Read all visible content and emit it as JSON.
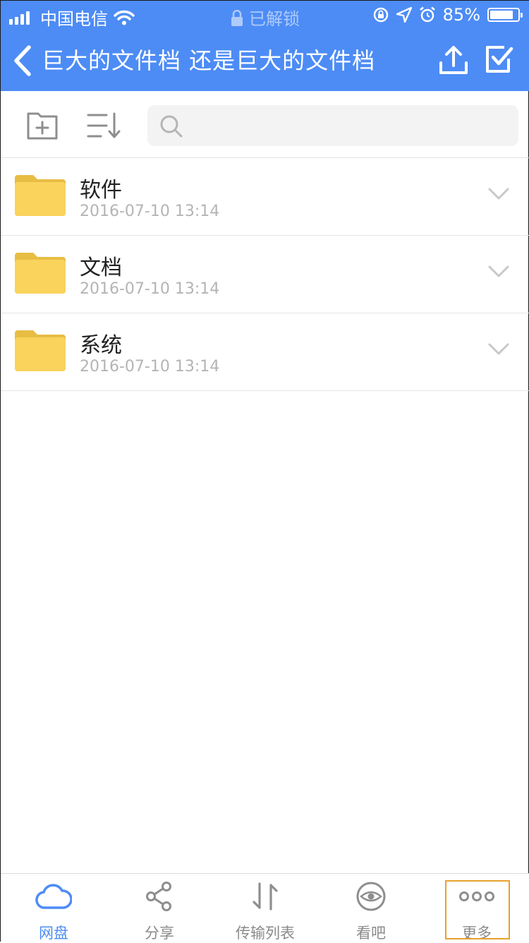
{
  "status_bar": {
    "carrier": "中国电信",
    "lock_text": "已解锁",
    "battery": "85%",
    "battery_level": 0.85
  },
  "nav": {
    "title": "巨大的文件档  还是巨大的文件档"
  },
  "toolbar": {
    "search_placeholder": ""
  },
  "files": [
    {
      "name": "软件",
      "date": "2016-07-10 13:14"
    },
    {
      "name": "文档",
      "date": "2016-07-10 13:14"
    },
    {
      "name": "系统",
      "date": "2016-07-10 13:14"
    }
  ],
  "tabs": [
    {
      "label": "网盘",
      "icon": "cloud-icon",
      "active": true
    },
    {
      "label": "分享",
      "icon": "share-icon",
      "active": false
    },
    {
      "label": "传输列表",
      "icon": "transfer-icon",
      "active": false
    },
    {
      "label": "看吧",
      "icon": "eye-icon",
      "active": false
    },
    {
      "label": "更多",
      "icon": "more-icon",
      "active": false
    }
  ],
  "colors": {
    "accent": "#4d8cf5",
    "folder": "#f9d35c",
    "highlight": "#e8a12d"
  }
}
